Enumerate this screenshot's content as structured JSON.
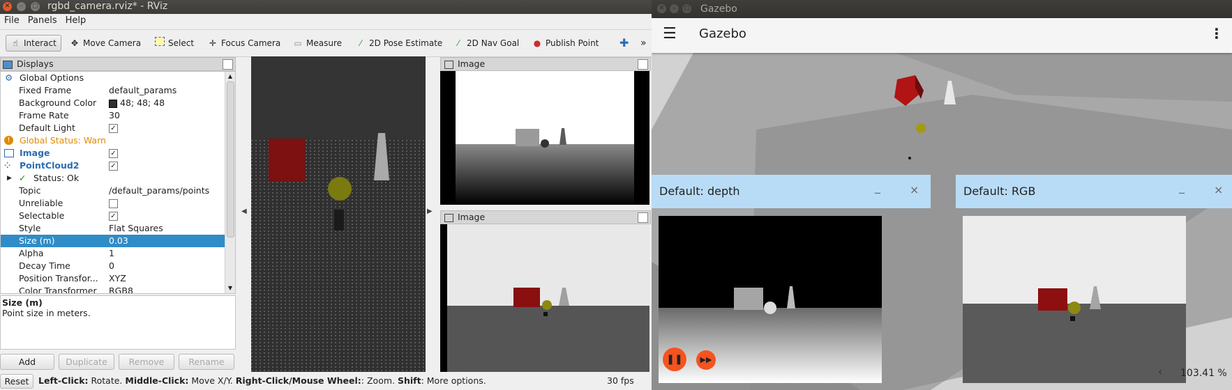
{
  "rviz": {
    "window_title": "rgbd_camera.rviz* - RViz",
    "menu": [
      "File",
      "Panels",
      "Help"
    ],
    "toolbar": {
      "interact": "Interact",
      "move_camera": "Move Camera",
      "select": "Select",
      "focus_camera": "Focus Camera",
      "measure": "Measure",
      "pose_estimate": "2D Pose Estimate",
      "nav_goal": "2D Nav Goal",
      "publish_point": "Publish Point",
      "more": "»"
    },
    "displays": {
      "title": "Displays",
      "rows": {
        "global_options": "Global Options",
        "fixed_frame_k": "Fixed Frame",
        "fixed_frame_v": "default_params",
        "bg_color_k": "Background Color",
        "bg_color_v": "48; 48; 48",
        "frame_rate_k": "Frame Rate",
        "frame_rate_v": "30",
        "default_light_k": "Default Light",
        "global_status": "Global Status: Warn",
        "image": "Image",
        "pointcloud": "PointCloud2",
        "status_ok": "Status: Ok",
        "topic_k": "Topic",
        "topic_v": "/default_params/points",
        "unreliable_k": "Unreliable",
        "selectable_k": "Selectable",
        "style_k": "Style",
        "style_v": "Flat Squares",
        "size_k": "Size (m)",
        "size_v": "0.03",
        "alpha_k": "Alpha",
        "alpha_v": "1",
        "decay_k": "Decay Time",
        "decay_v": "0",
        "pos_trans_k": "Position Transfor...",
        "pos_trans_v": "XYZ",
        "color_trans_k": "Color Transformer",
        "color_trans_v": "RGB8"
      },
      "description_title": "Size (m)",
      "description_text": "Point size in meters.",
      "buttons": {
        "add": "Add",
        "duplicate": "Duplicate",
        "remove": "Remove",
        "rename": "Rename"
      }
    },
    "image_panel_1_title": "Image",
    "image_panel_2_title": "Image",
    "status": {
      "reset": "Reset",
      "hint_b1": "Left-Click:",
      "hint_t1": " Rotate. ",
      "hint_b2": "Middle-Click:",
      "hint_t2": " Move X/Y. ",
      "hint_b3": "Right-Click/Mouse Wheel:",
      "hint_t3": ": Zoom. ",
      "hint_b4": "Shift",
      "hint_t4": ": More options.",
      "fps": "30 fps"
    },
    "colors": {
      "selection": "#308cc6",
      "warn": "#e08a00",
      "link_blue": "#2a6db3"
    }
  },
  "gazebo": {
    "window_title": "Gazebo",
    "app_title": "Gazebo",
    "depth_panel_title": "Default: depth",
    "rgb_panel_title": "Default: RGB",
    "minimize": "_",
    "close": "×",
    "zoom": "103.41 %",
    "zoom_prev": "‹",
    "colors": {
      "panel_header": "#b9dcf6",
      "control": "#f5531f"
    }
  }
}
